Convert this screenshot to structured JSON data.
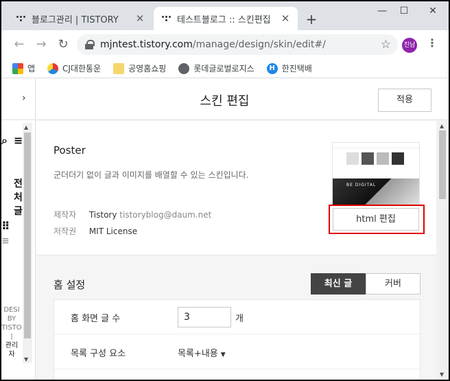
{
  "browser": {
    "tabs": [
      {
        "title": "블로그관리 | TISTORY",
        "active": false
      },
      {
        "title": "테스트블로그 :: 스킨편집",
        "active": true
      }
    ],
    "new_tab": "+",
    "window_controls": {
      "minimize": "—",
      "maximize": "☐",
      "close": "✕"
    },
    "nav": {
      "back": "←",
      "forward": "→",
      "reload": "↻"
    },
    "url_host": "mjntest.tistory.com",
    "url_path": "/manage/design/skin/edit#/",
    "star": "☆",
    "profile_initials": "진남",
    "menu": "⋮",
    "bookmarks": [
      {
        "label": "앱",
        "icon": "apps-icon"
      },
      {
        "label": "CJ대한통운",
        "icon": "cj-logo-icon"
      },
      {
        "label": "공영홈쇼핑",
        "icon": "folder-icon"
      },
      {
        "label": "롯데글로벌로지스",
        "icon": "globe-icon"
      },
      {
        "label": "한진택배",
        "icon": "hanjin-logo-icon"
      }
    ]
  },
  "left_pane": {
    "toggle": "›",
    "fragments": [
      "전",
      "처",
      "글"
    ],
    "footer_lines": [
      "DESI",
      "BY",
      "TISTO",
      "|",
      "관리",
      "자"
    ]
  },
  "header": {
    "title": "스킨 편집",
    "apply_button": "적용"
  },
  "skin": {
    "name": "Poster",
    "description": "군더더기 없이 글과 이미지를 배열할 수 있는 스킨입니다.",
    "maker_label": "제작자",
    "maker": "Tistory",
    "maker_email": "tistoryblog@daum.net",
    "license_label": "저작권",
    "license": "MIT License",
    "preview_caption": "BE DIGITAL",
    "html_edit_button": "html 편집"
  },
  "home_settings": {
    "title": "홈 설정",
    "toggle": [
      {
        "label": "최신 글",
        "selected": true
      },
      {
        "label": "커버",
        "selected": false
      }
    ],
    "rows": [
      {
        "label": "홈 화면 글 수",
        "value": "3",
        "unit": "개"
      },
      {
        "label": "목록 구성 요소",
        "value": "목록+내용",
        "caret": "▼"
      }
    ]
  }
}
